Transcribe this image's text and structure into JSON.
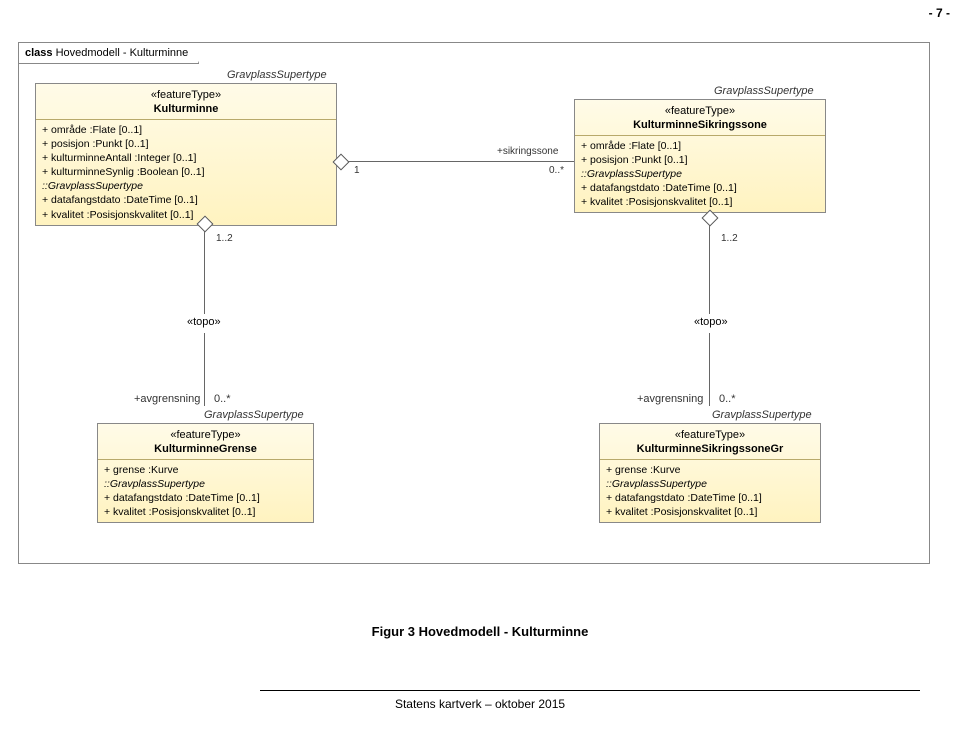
{
  "page_number": "- 7 -",
  "frame_title_prefix": "class ",
  "frame_title": "Hovedmodell - Kulturminne",
  "caption": "Figur 3 Hovedmodell - Kulturminne",
  "footer": "Statens kartverk – oktober 2015",
  "super_label": "GravplassSupertype",
  "stereo_feature": "«featureType»",
  "topo_label": "«topo»",
  "avgrensning_label": "+avgrensning",
  "sikringssone_label": "+sikringssone",
  "mult_0star": "0..*",
  "mult_1": "1",
  "mult_1_2": "1..2",
  "classes": {
    "kulturminne": {
      "name": "Kulturminne",
      "attrs": [
        "+   område :Flate [0..1]",
        "+   posisjon :Punkt [0..1]",
        "+   kulturminneAntall :Integer [0..1]",
        "+   kulturminneSynlig :Boolean [0..1]",
        "::GravplassSupertype",
        "+   datafangstdato :DateTime [0..1]",
        "+   kvalitet :Posisjonskvalitet [0..1]"
      ]
    },
    "sikringssone": {
      "name": "KulturminneSikringssone",
      "attrs": [
        "+   område :Flate [0..1]",
        "+   posisjon :Punkt [0..1]",
        "::GravplassSupertype",
        "+   datafangstdato :DateTime [0..1]",
        "+   kvalitet :Posisjonskvalitet [0..1]"
      ]
    },
    "grense": {
      "name": "KulturminneGrense",
      "attrs": [
        "+   grense :Kurve",
        "::GravplassSupertype",
        "+   datafangstdato :DateTime [0..1]",
        "+   kvalitet :Posisjonskvalitet [0..1]"
      ]
    },
    "sikringssonegr": {
      "name": "KulturminneSikringssoneGr",
      "attrs": [
        "+   grense :Kurve",
        "::GravplassSupertype",
        "+   datafangstdato :DateTime [0..1]",
        "+   kvalitet :Posisjonskvalitet [0..1]"
      ]
    }
  }
}
